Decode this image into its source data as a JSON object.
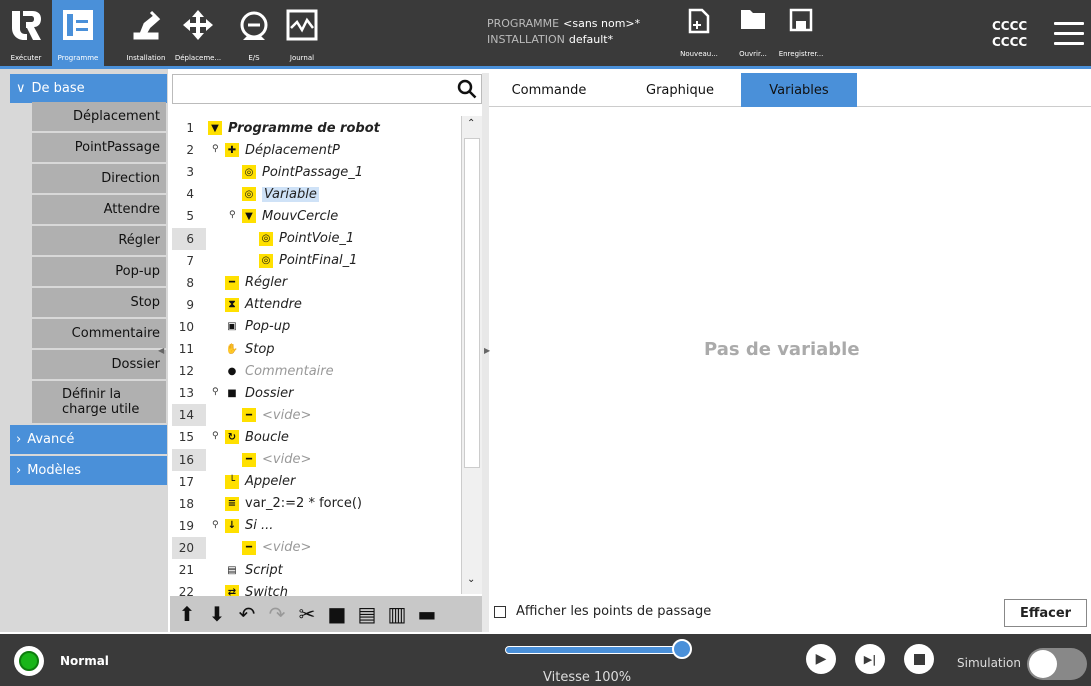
{
  "topnav": {
    "items": [
      {
        "label": "Exécuter"
      },
      {
        "label": "Programme"
      },
      {
        "label": "Installation"
      },
      {
        "label": "Déplaceme..."
      },
      {
        "label": "E/S"
      },
      {
        "label": "Journal"
      }
    ],
    "program_label": "PROGRAMME",
    "program_value": "<sans nom>*",
    "install_label": "INSTALLATION",
    "install_value": "default*",
    "new_label": "Nouveau...",
    "open_label": "Ouvrir...",
    "save_label": "Enregistrer...",
    "user_line1": "CCCC",
    "user_line2": "CCCC"
  },
  "sidebar": {
    "basic": "De base",
    "advanced": "Avancé",
    "templates": "Modèles",
    "items": [
      "Déplacement",
      "PointPassage",
      "Direction",
      "Attendre",
      "Régler",
      "Pop-up",
      "Stop",
      "Commentaire",
      "Dossier",
      "Définir la charge utile"
    ]
  },
  "tree": {
    "line_numbers": [
      "1",
      "2",
      "3",
      "4",
      "5",
      "6",
      "7",
      "8",
      "9",
      "10",
      "11",
      "12",
      "13",
      "14",
      "15",
      "16",
      "17",
      "18",
      "19",
      "20",
      "21",
      "22"
    ],
    "nodes": [
      {
        "text": "Programme de robot",
        "icon": "program-icon"
      },
      {
        "text": "DéplacementP",
        "icon": "move-icon"
      },
      {
        "text": "PointPassage_1",
        "icon": "waypoint-icon"
      },
      {
        "text": "Variable",
        "icon": "waypoint-icon"
      },
      {
        "text": "MouvCercle",
        "icon": "circle-move-icon"
      },
      {
        "text": "PointVoie_1",
        "icon": "waypoint-icon"
      },
      {
        "text": "PointFinal_1",
        "icon": "waypoint-icon"
      },
      {
        "text": "Régler",
        "icon": "set-icon"
      },
      {
        "text": "Attendre",
        "icon": "hourglass-icon"
      },
      {
        "text": "Pop-up",
        "icon": "popup-icon"
      },
      {
        "text": "Stop",
        "icon": "stop-hand-icon"
      },
      {
        "text": "Commentaire",
        "icon": "comment-icon"
      },
      {
        "text": "Dossier",
        "icon": "folder-icon"
      },
      {
        "text": "<vide>",
        "icon": "empty-icon"
      },
      {
        "text": "Boucle",
        "icon": "loop-icon"
      },
      {
        "text": "<vide>",
        "icon": "empty-icon"
      },
      {
        "text": "Appeler",
        "icon": "call-icon"
      },
      {
        "text": "var_2:=2 * force()",
        "icon": "assignment-icon"
      },
      {
        "text": "Si ...",
        "icon": "if-icon"
      },
      {
        "text": "<vide>",
        "icon": "empty-icon"
      },
      {
        "text": "Script",
        "icon": "script-icon"
      },
      {
        "text": "Switch",
        "icon": "switch-icon"
      }
    ]
  },
  "tabs": [
    "Commande",
    "Graphique",
    "Variables"
  ],
  "variables_empty": "Pas de variable",
  "show_waypoints": "Afficher les points de passage",
  "clear_button": "Effacer",
  "footer": {
    "status": "Normal",
    "speed": "Vitesse 100%",
    "speed_fraction": 1.0,
    "simulation": "Simulation"
  }
}
